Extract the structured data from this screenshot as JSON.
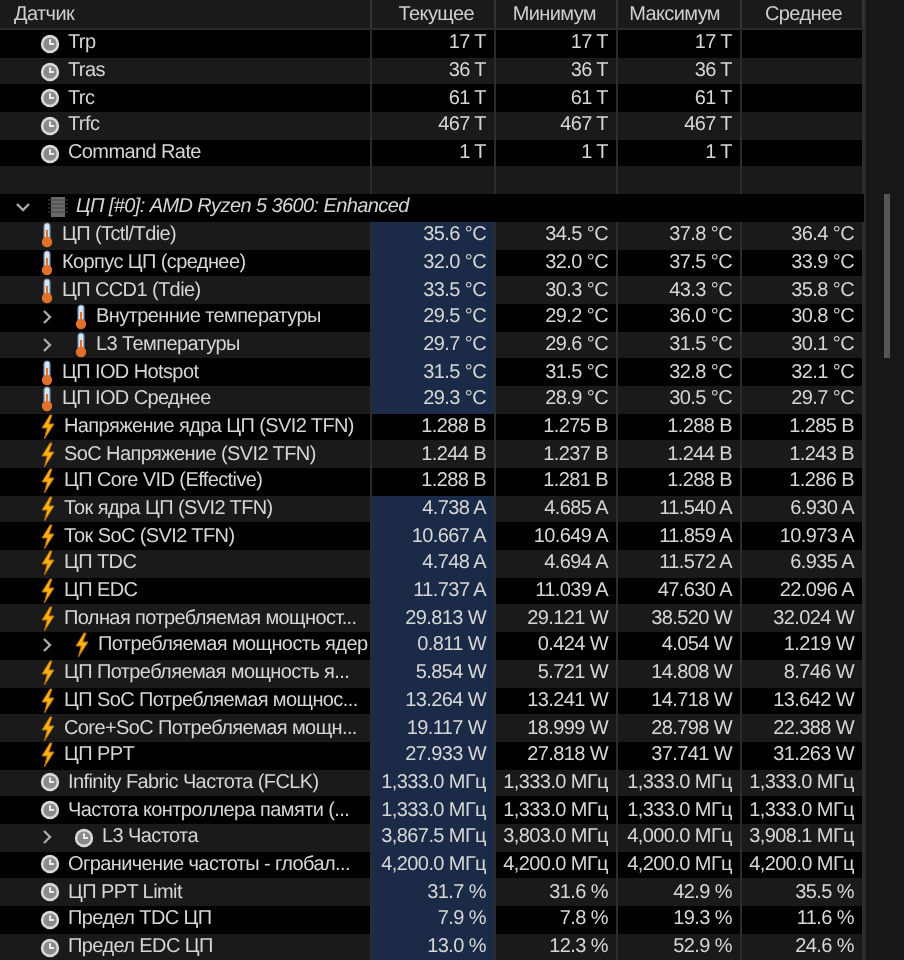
{
  "columns": [
    "Датчик",
    "Текущее",
    "Минимум",
    "Максимум",
    "Среднее"
  ],
  "rows": [
    {
      "kind": "clock",
      "label": "Trp",
      "current": "17 T",
      "min": "17 T",
      "max": "17 T",
      "highlighted": false
    },
    {
      "kind": "clock",
      "label": "Tras",
      "current": "36 T",
      "min": "36 T",
      "max": "36 T",
      "highlighted": false
    },
    {
      "kind": "clock",
      "label": "Trc",
      "current": "61 T",
      "min": "61 T",
      "max": "61 T",
      "highlighted": false
    },
    {
      "kind": "clock",
      "label": "Trfc",
      "current": "467 T",
      "min": "467 T",
      "max": "467 T",
      "highlighted": false
    },
    {
      "kind": "clock",
      "label": "Command Rate",
      "current": "1 T",
      "min": "1 T",
      "max": "1 T",
      "highlighted": false
    },
    {
      "kind": "blank"
    },
    {
      "kind": "group",
      "label": "ЦП [#0]: AMD Ryzen 5 3600: Enhanced",
      "expanded": true,
      "children": [
        {
          "kind": "temp",
          "label": "ЦП (Tctl/Tdie)",
          "current": "35.6 °C",
          "min": "34.5 °C",
          "max": "37.8 °C",
          "avg": "36.4 °C",
          "highlighted": true
        },
        {
          "kind": "temp",
          "label": "Корпус ЦП (среднее)",
          "current": "32.0 °C",
          "min": "32.0 °C",
          "max": "37.5 °C",
          "avg": "33.9 °C",
          "highlighted": true
        },
        {
          "kind": "temp",
          "label": "ЦП CCD1 (Tdie)",
          "current": "33.5 °C",
          "min": "30.3 °C",
          "max": "43.3 °C",
          "avg": "35.8 °C",
          "highlighted": true
        },
        {
          "kind": "temp",
          "label": "Внутренние температуры",
          "expanded": false,
          "current": "29.5 °C",
          "min": "29.2 °C",
          "max": "36.0 °C",
          "avg": "30.8 °C",
          "highlighted": true
        },
        {
          "kind": "temp",
          "label": "L3 Температуры",
          "expanded": false,
          "current": "29.7 °C",
          "min": "29.6 °C",
          "max": "31.5 °C",
          "avg": "30.1 °C",
          "highlighted": true
        },
        {
          "kind": "temp",
          "label": "ЦП IOD Hotspot",
          "current": "31.5 °C",
          "min": "31.5 °C",
          "max": "32.8 °C",
          "avg": "32.1 °C",
          "highlighted": true
        },
        {
          "kind": "temp",
          "label": "ЦП IOD Среднее",
          "current": "29.3 °C",
          "min": "28.9 °C",
          "max": "30.5 °C",
          "avg": "29.7 °C",
          "highlighted": true
        },
        {
          "kind": "power",
          "label": "Напряжение ядра ЦП (SVI2 TFN)",
          "current": "1.288 В",
          "min": "1.275 В",
          "max": "1.288 В",
          "avg": "1.285 В",
          "highlighted": false
        },
        {
          "kind": "power",
          "label": "SoC Напряжение (SVI2 TFN)",
          "current": "1.244 В",
          "min": "1.237 В",
          "max": "1.244 В",
          "avg": "1.243 В",
          "highlighted": false
        },
        {
          "kind": "power",
          "label": "ЦП Core VID (Effective)",
          "current": "1.288 В",
          "min": "1.281 В",
          "max": "1.288 В",
          "avg": "1.286 В",
          "highlighted": false
        },
        {
          "kind": "power",
          "label": "Ток ядра ЦП (SVI2 TFN)",
          "current": "4.738 A",
          "min": "4.685 A",
          "max": "11.540 A",
          "avg": "6.930 A",
          "highlighted": true
        },
        {
          "kind": "power",
          "label": "Ток SoC (SVI2 TFN)",
          "current": "10.667 A",
          "min": "10.649 A",
          "max": "11.859 A",
          "avg": "10.973 A",
          "highlighted": true
        },
        {
          "kind": "power",
          "label": "ЦП TDC",
          "current": "4.748 A",
          "min": "4.694 A",
          "max": "11.572 A",
          "avg": "6.935 A",
          "highlighted": true
        },
        {
          "kind": "power",
          "label": "ЦП EDC",
          "current": "11.737 A",
          "min": "11.039 A",
          "max": "47.630 A",
          "avg": "22.096 A",
          "highlighted": true
        },
        {
          "kind": "power",
          "label": "Полная потребляемая мощност...",
          "current": "29.813 W",
          "min": "29.121 W",
          "max": "38.520 W",
          "avg": "32.024 W",
          "highlighted": true
        },
        {
          "kind": "power",
          "label": "Потребляемая мощность ядер",
          "expanded": false,
          "current": "0.811 W",
          "min": "0.424 W",
          "max": "4.054 W",
          "avg": "1.219 W",
          "highlighted": true
        },
        {
          "kind": "power",
          "label": "ЦП Потребляемая мощность я...",
          "current": "5.854 W",
          "min": "5.721 W",
          "max": "14.808 W",
          "avg": "8.746 W",
          "highlighted": true
        },
        {
          "kind": "power",
          "label": "ЦП SoC Потребляемая мощнос...",
          "current": "13.264 W",
          "min": "13.241 W",
          "max": "14.718 W",
          "avg": "13.642 W",
          "highlighted": true
        },
        {
          "kind": "power",
          "label": "Core+SoC Потребляемая мощн...",
          "current": "19.117 W",
          "min": "18.999 W",
          "max": "28.798 W",
          "avg": "22.388 W",
          "highlighted": true
        },
        {
          "kind": "power",
          "label": "ЦП PPT",
          "current": "27.933 W",
          "min": "27.818 W",
          "max": "37.741 W",
          "avg": "31.263 W",
          "highlighted": true
        },
        {
          "kind": "clock",
          "label": "Infinity Fabric Частота (FCLK)",
          "current": "1,333.0 МГц",
          "min": "1,333.0 МГц",
          "max": "1,333.0 МГц",
          "avg": "1,333.0 МГц",
          "highlighted": true
        },
        {
          "kind": "clock",
          "label": "Частота контроллера памяти (...",
          "current": "1,333.0 МГц",
          "min": "1,333.0 МГц",
          "max": "1,333.0 МГц",
          "avg": "1,333.0 МГц",
          "highlighted": true
        },
        {
          "kind": "clock",
          "label": "L3 Частота",
          "expanded": false,
          "current": "3,867.5 МГц",
          "min": "3,803.0 МГц",
          "max": "4,000.0 МГц",
          "avg": "3,908.1 МГц",
          "highlighted": true
        },
        {
          "kind": "clock",
          "label": "Ограничение частоты - глобал...",
          "current": "4,200.0 МГц",
          "min": "4,200.0 МГц",
          "max": "4,200.0 МГц",
          "avg": "4,200.0 МГц",
          "highlighted": true
        },
        {
          "kind": "clock",
          "label": "ЦП PPT Limit",
          "current": "31.7 %",
          "min": "31.6 %",
          "max": "42.9 %",
          "avg": "35.5 %",
          "highlighted": true
        },
        {
          "kind": "clock",
          "label": "Предел TDC ЦП",
          "current": "7.9 %",
          "min": "7.8 %",
          "max": "19.3 %",
          "avg": "11.6 %",
          "highlighted": true
        },
        {
          "kind": "clock",
          "label": "Предел EDC ЦП",
          "current": "13.0 %",
          "min": "12.3 %",
          "max": "52.9 %",
          "avg": "24.6 %",
          "highlighted": true
        }
      ]
    }
  ]
}
